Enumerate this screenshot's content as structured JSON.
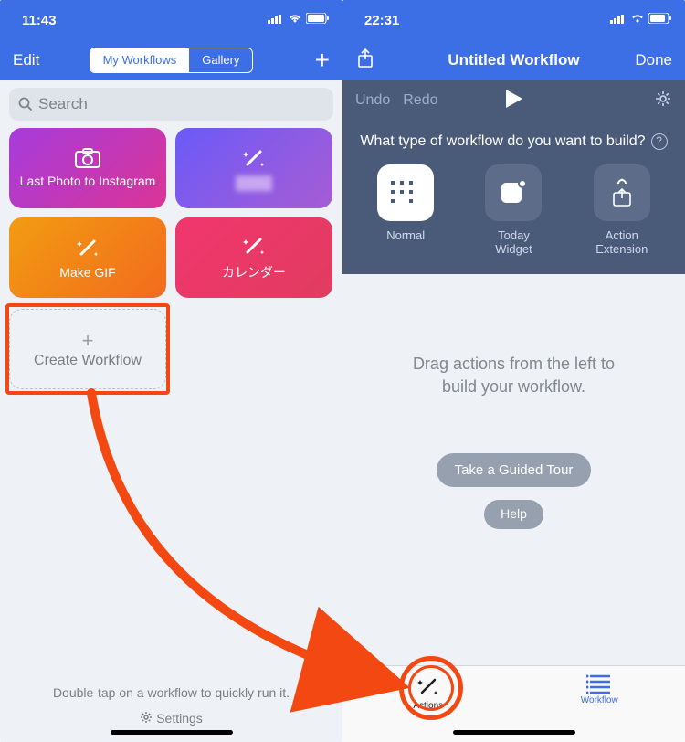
{
  "left": {
    "status_time": "11:43",
    "nav_edit": "Edit",
    "seg_my": "My Workflows",
    "seg_gallery": "Gallery",
    "search_placeholder": "Search",
    "cards": {
      "c1": "Last Photo to Instagram",
      "c2": "",
      "c3": "Make GIF",
      "c4": "カレンダー"
    },
    "create": "Create Workflow",
    "hint": "Double-tap on a workflow to quickly run it.",
    "settings": "Settings"
  },
  "right": {
    "status_time": "22:31",
    "title": "Untitled Workflow",
    "done": "Done",
    "undo": "Undo",
    "redo": "Redo",
    "question": "What type of workflow do you want to build?",
    "type_normal": "Normal",
    "type_widget_1": "Today",
    "type_widget_2": "Widget",
    "type_ext_1": "Action",
    "type_ext_2": "Extension",
    "drag_1": "Drag actions from the left to",
    "drag_2": "build your workflow.",
    "tour": "Take a Guided Tour",
    "help": "Help",
    "tab_actions": "Actions",
    "tab_workflow": "Workflow"
  }
}
